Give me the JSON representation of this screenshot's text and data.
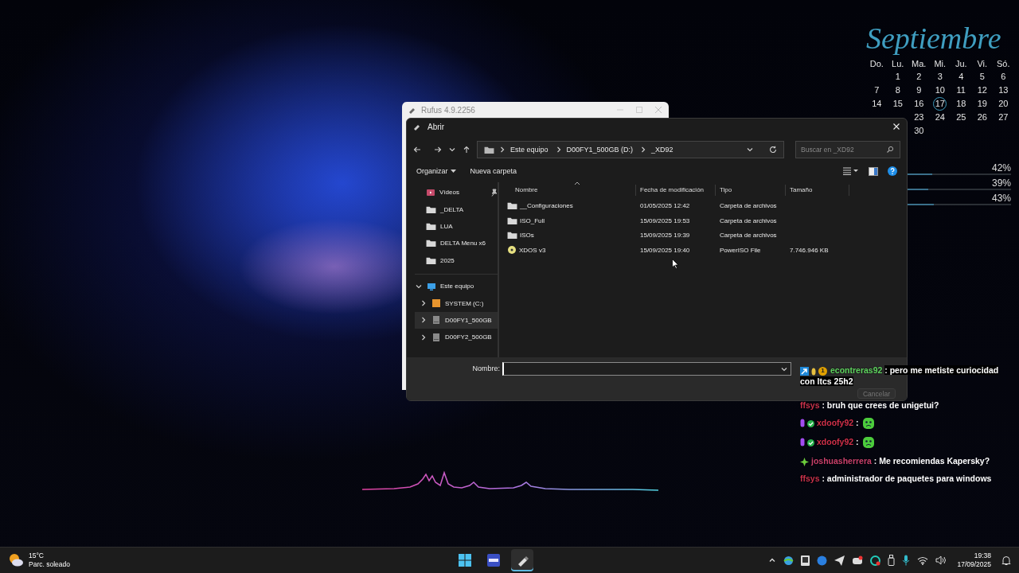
{
  "calendar": {
    "month": "Septiembre",
    "weekdays": [
      "Do.",
      "Lu.",
      "Ma.",
      "Mi.",
      "Ju.",
      "Vi.",
      "Só."
    ],
    "weeks": [
      {
        "kind": "end",
        "days": [
          {
            "label": "1",
            "selected": false
          },
          {
            "label": "2",
            "selected": false
          },
          {
            "label": "3",
            "selected": false
          },
          {
            "label": "4",
            "selected": false
          },
          {
            "label": "5",
            "selected": false
          },
          {
            "label": "6",
            "selected": false
          }
        ]
      },
      {
        "kind": "full",
        "days": [
          {
            "label": "7",
            "selected": false
          },
          {
            "label": "8",
            "selected": false
          },
          {
            "label": "9",
            "selected": false
          },
          {
            "label": "10",
            "selected": false
          },
          {
            "label": "11",
            "selected": false
          },
          {
            "label": "12",
            "selected": false
          },
          {
            "label": "13",
            "selected": false
          }
        ]
      },
      {
        "kind": "full",
        "days": [
          {
            "label": "14",
            "selected": false
          },
          {
            "label": "15",
            "selected": false
          },
          {
            "label": "16",
            "selected": false
          },
          {
            "label": "17",
            "selected": true
          },
          {
            "label": "18",
            "selected": false
          },
          {
            "label": "19",
            "selected": false
          },
          {
            "label": "20",
            "selected": false
          }
        ]
      },
      {
        "kind": "end",
        "days": [
          {
            "label": "23",
            "selected": false
          },
          {
            "label": "24",
            "selected": false
          },
          {
            "label": "25",
            "selected": false
          },
          {
            "label": "26",
            "selected": false
          },
          {
            "label": "27",
            "selected": false
          }
        ]
      },
      {
        "kind": "mid",
        "days": [
          {
            "label": "30",
            "selected": false
          }
        ]
      }
    ]
  },
  "meters": [
    {
      "reading": "42%",
      "level": 0.42
    },
    {
      "reading": "39%",
      "level": 0.39
    },
    {
      "reading": "43%",
      "level": 0.43
    }
  ],
  "rufus_window": {
    "title": "Rufus 4.9.2256"
  },
  "dialog": {
    "title": "Abrir",
    "breadcrumbs": [
      "Este equipo",
      "D00FY1_500GB (D:)",
      "_XD92"
    ],
    "search": {
      "placeholder": "Buscar en _XD92"
    },
    "toolbar": [
      {
        "label": "Organizar",
        "dropdown": true
      },
      {
        "label": "Nueva carpeta",
        "dropdown": false
      }
    ],
    "quick_access": [
      {
        "label": "Vídeos",
        "kind": "video",
        "pinned": true
      },
      {
        "label": "_DELTA",
        "kind": "folder",
        "pinned": false
      },
      {
        "label": "LUA",
        "kind": "folder",
        "pinned": false
      },
      {
        "label": "DELTA Menu x6",
        "kind": "folder",
        "pinned": false
      },
      {
        "label": "2025",
        "kind": "folder",
        "pinned": false
      }
    ],
    "this_pc": {
      "label": "Este equipo",
      "expanded": true,
      "children": [
        {
          "label": "SYSTEM (C:)",
          "kind": "system",
          "selected": false,
          "expanded": false
        },
        {
          "label": "D00FY1_500GB",
          "kind": "drive",
          "selected": true,
          "expanded": false
        },
        {
          "label": "D00FY2_500GB",
          "kind": "drive",
          "selected": false,
          "expanded": false
        }
      ]
    },
    "columns": [
      "Nombre",
      "Fecha de modificación",
      "Tipo",
      "Tamaño"
    ],
    "files": [
      {
        "name": "__Configuraciones",
        "kind": "folder",
        "date": "01/05/2025 12:42",
        "type": "Carpeta de archivos"
      },
      {
        "name": "ISO_Full",
        "kind": "folder",
        "date": "15/09/2025 19:53",
        "type": "Carpeta de archivos"
      },
      {
        "name": "ISOs",
        "kind": "folder",
        "date": "15/09/2025 19:39",
        "type": "Carpeta de archivos"
      },
      {
        "name": "XDOS v3",
        "kind": "disc",
        "date": "15/09/2025 19:40",
        "type": "PowerISO File",
        "size": "7.746.946 KB"
      }
    ],
    "filename_label": "Nombre:",
    "cancel_button": "Cancelar"
  },
  "chat": [
    {
      "badges": [
        {
          "kind": "prime"
        },
        {
          "kind": "bits"
        },
        {
          "kind": "coin",
          "label": "1"
        }
      ],
      "user": "econtreras92",
      "color": "#5fd35f",
      "text": ": pero me metiste curiocidad con ltcs 25h2"
    },
    {
      "user": "ffsys",
      "color": "#c8324a",
      "text": ": bruh que crees de unigetui?"
    },
    {
      "badges": [
        {
          "kind": "mic"
        },
        {
          "kind": "check"
        }
      ],
      "user": "xdoofy92",
      "color": "#d0304a",
      "text": ":",
      "emotes": [
        {
          "kind": "frown"
        }
      ]
    },
    {
      "badges": [
        {
          "kind": "mic"
        },
        {
          "kind": "check"
        }
      ],
      "user": "xdoofy92",
      "color": "#d0304a",
      "text": ":",
      "emotes": [
        {
          "kind": "frown"
        }
      ]
    },
    {
      "badges": [
        {
          "kind": "diamond"
        }
      ],
      "user": "joshuasherrera",
      "color": "#c8406a",
      "text": ": Me recomiendas Kapersky?"
    },
    {
      "user": "ffsys",
      "color": "#c8324a",
      "text": ": administrador de paquetes para windows"
    }
  ],
  "taskbar": {
    "weather": {
      "temperature": "15°C",
      "condition": "Parc. soleado"
    },
    "apps": [
      {
        "kind": "start",
        "selected": false
      },
      {
        "kind": "mdd",
        "selected": false
      },
      {
        "kind": "rufus",
        "selected": true
      }
    ],
    "time": "19:38",
    "date": "17/09/2025"
  }
}
